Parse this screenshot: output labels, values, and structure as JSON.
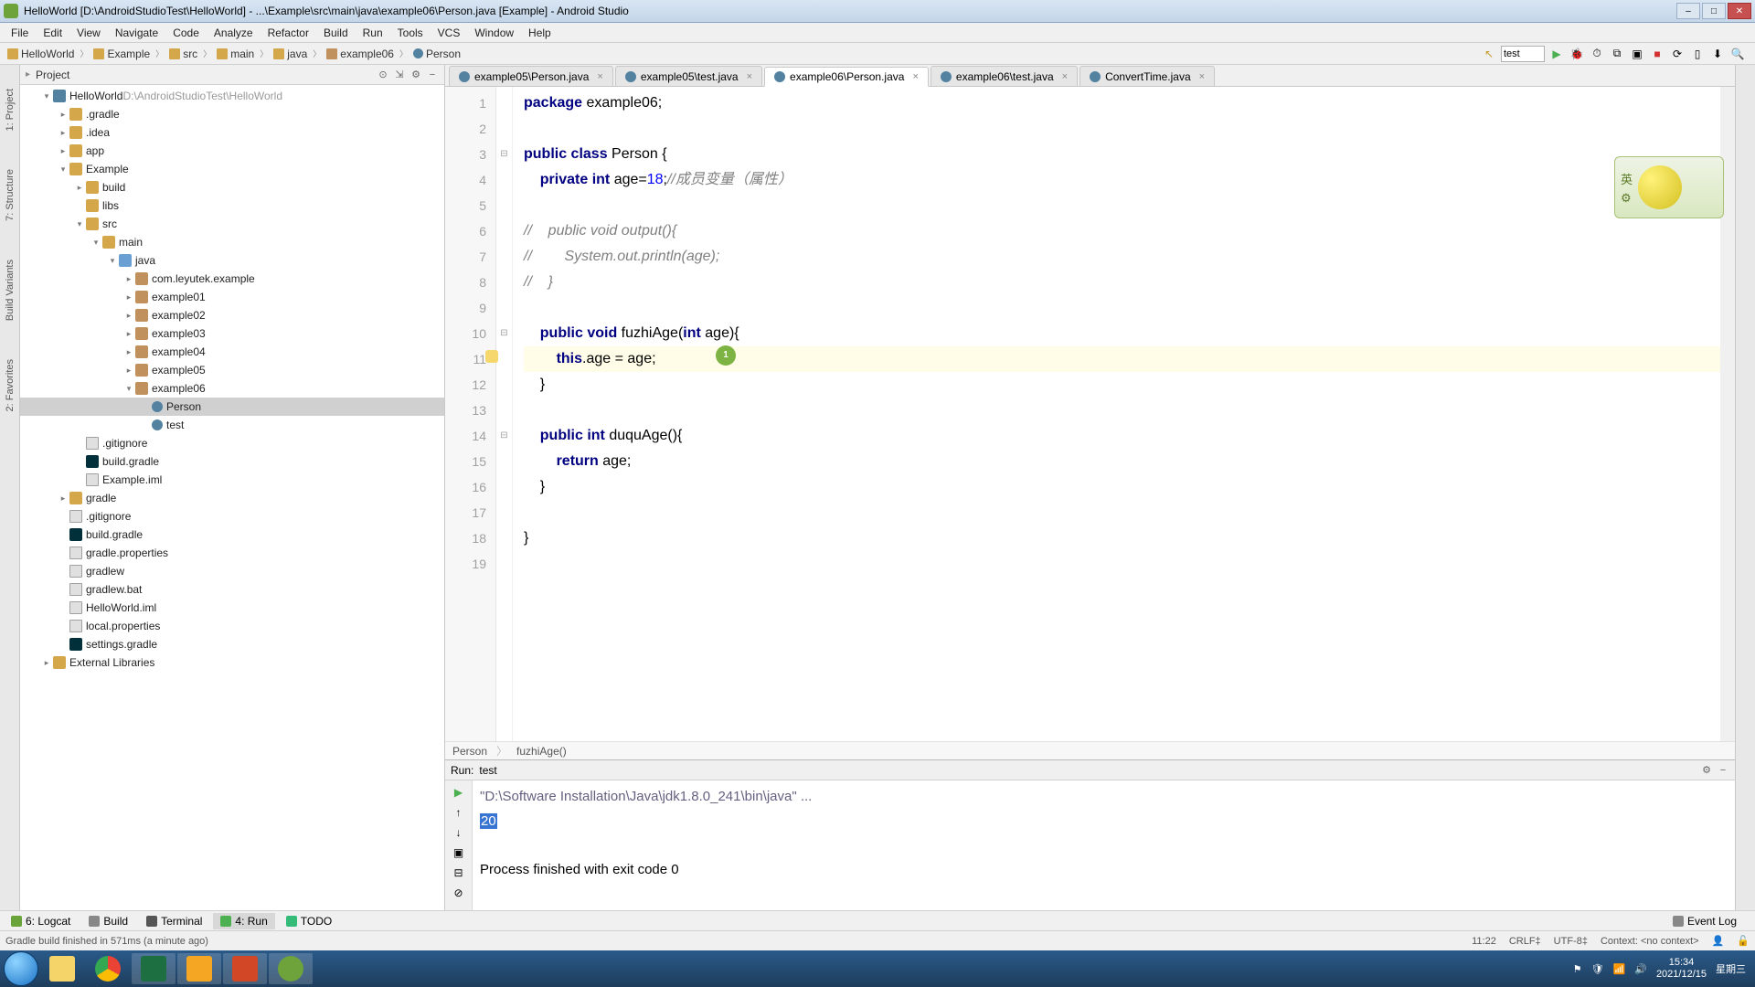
{
  "title": "HelloWorld  [D:\\AndroidStudioTest\\HelloWorld] - ...\\Example\\src\\main\\java\\example06\\Person.java [Example] - Android Studio",
  "menu": [
    "File",
    "Edit",
    "View",
    "Navigate",
    "Code",
    "Analyze",
    "Refactor",
    "Build",
    "Run",
    "Tools",
    "VCS",
    "Window",
    "Help"
  ],
  "breadcrumbs": [
    {
      "icon": "mod",
      "label": "HelloWorld"
    },
    {
      "icon": "mod",
      "label": "Example"
    },
    {
      "icon": "folder",
      "label": "src"
    },
    {
      "icon": "folder",
      "label": "main"
    },
    {
      "icon": "folder",
      "label": "java"
    },
    {
      "icon": "pkg",
      "label": "example06"
    },
    {
      "icon": "class",
      "label": "Person"
    }
  ],
  "run_config": "test",
  "left_gutter": [
    "1: Project",
    "7: Structure",
    "Build Variants",
    "2: Favorites"
  ],
  "project_panel": {
    "title": "Project"
  },
  "tree_root": {
    "name": "HelloWorld",
    "path": "D:\\AndroidStudioTest\\HelloWorld"
  },
  "tree": [
    {
      "d": 1,
      "ar": "▾",
      "ic": "mod",
      "t": "HelloWorld",
      "extra": "  D:\\AndroidStudioTest\\HelloWorld"
    },
    {
      "d": 2,
      "ar": "▸",
      "ic": "folder",
      "t": ".gradle"
    },
    {
      "d": 2,
      "ar": "▸",
      "ic": "folder",
      "t": ".idea"
    },
    {
      "d": 2,
      "ar": "▸",
      "ic": "folder",
      "t": "app"
    },
    {
      "d": 2,
      "ar": "▾",
      "ic": "folder",
      "t": "Example"
    },
    {
      "d": 3,
      "ar": "▸",
      "ic": "folder",
      "t": "build"
    },
    {
      "d": 3,
      "ar": " ",
      "ic": "folder",
      "t": "libs"
    },
    {
      "d": 3,
      "ar": "▾",
      "ic": "folder",
      "t": "src"
    },
    {
      "d": 4,
      "ar": "▾",
      "ic": "folder",
      "t": "main"
    },
    {
      "d": 5,
      "ar": "▾",
      "ic": "folder-blue",
      "t": "java"
    },
    {
      "d": 6,
      "ar": "▸",
      "ic": "pkg",
      "t": "com.leyutek.example"
    },
    {
      "d": 6,
      "ar": "▸",
      "ic": "pkg",
      "t": "example01"
    },
    {
      "d": 6,
      "ar": "▸",
      "ic": "pkg",
      "t": "example02"
    },
    {
      "d": 6,
      "ar": "▸",
      "ic": "pkg",
      "t": "example03"
    },
    {
      "d": 6,
      "ar": "▸",
      "ic": "pkg",
      "t": "example04"
    },
    {
      "d": 6,
      "ar": "▸",
      "ic": "pkg",
      "t": "example05"
    },
    {
      "d": 6,
      "ar": "▾",
      "ic": "pkg",
      "t": "example06"
    },
    {
      "d": 7,
      "ar": " ",
      "ic": "class",
      "t": "Person",
      "sel": true
    },
    {
      "d": 7,
      "ar": " ",
      "ic": "class",
      "t": "test"
    },
    {
      "d": 3,
      "ar": " ",
      "ic": "file",
      "t": ".gitignore"
    },
    {
      "d": 3,
      "ar": " ",
      "ic": "gradle",
      "t": "build.gradle"
    },
    {
      "d": 3,
      "ar": " ",
      "ic": "file",
      "t": "Example.iml"
    },
    {
      "d": 2,
      "ar": "▸",
      "ic": "folder",
      "t": "gradle"
    },
    {
      "d": 2,
      "ar": " ",
      "ic": "file",
      "t": ".gitignore"
    },
    {
      "d": 2,
      "ar": " ",
      "ic": "gradle",
      "t": "build.gradle"
    },
    {
      "d": 2,
      "ar": " ",
      "ic": "file",
      "t": "gradle.properties"
    },
    {
      "d": 2,
      "ar": " ",
      "ic": "file",
      "t": "gradlew"
    },
    {
      "d": 2,
      "ar": " ",
      "ic": "file",
      "t": "gradlew.bat"
    },
    {
      "d": 2,
      "ar": " ",
      "ic": "file",
      "t": "HelloWorld.iml"
    },
    {
      "d": 2,
      "ar": " ",
      "ic": "file",
      "t": "local.properties"
    },
    {
      "d": 2,
      "ar": " ",
      "ic": "gradle",
      "t": "settings.gradle"
    },
    {
      "d": 1,
      "ar": "▸",
      "ic": "folder",
      "t": "External Libraries"
    }
  ],
  "tabs": [
    {
      "label": "example05\\Person.java"
    },
    {
      "label": "example05\\test.java"
    },
    {
      "label": "example06\\Person.java",
      "active": true
    },
    {
      "label": "example06\\test.java"
    },
    {
      "label": "ConvertTime.java"
    }
  ],
  "code": {
    "lines": [
      [
        [
          "kw",
          "package "
        ],
        [
          "id",
          "example06"
        ],
        [
          "id",
          ";"
        ]
      ],
      [],
      [
        [
          "kw",
          "public class "
        ],
        [
          "id",
          "Person {"
        ]
      ],
      [
        [
          "id",
          "    "
        ],
        [
          "kw",
          "private int "
        ],
        [
          "id",
          "age="
        ],
        [
          "num",
          "18"
        ],
        [
          "id",
          ";"
        ],
        [
          "cmt",
          "//成员变量（属性）"
        ]
      ],
      [],
      [
        [
          "cmt",
          "//    public void output(){"
        ]
      ],
      [
        [
          "cmt",
          "//        System.out.println(age);"
        ]
      ],
      [
        [
          "cmt",
          "//    }"
        ]
      ],
      [],
      [
        [
          "id",
          "    "
        ],
        [
          "kw",
          "public void "
        ],
        [
          "id",
          "fuzhiAge("
        ],
        [
          "kw",
          "int "
        ],
        [
          "id",
          "age"
        ],
        [
          "id",
          "){"
        ]
      ],
      [
        [
          "id",
          "        "
        ],
        [
          "kw",
          "this"
        ],
        [
          "id",
          ".age = age;"
        ]
      ],
      [
        [
          "id",
          "    }"
        ]
      ],
      [],
      [
        [
          "id",
          "    "
        ],
        [
          "kw",
          "public int "
        ],
        [
          "id",
          "duquAge(){"
        ]
      ],
      [
        [
          "id",
          "        "
        ],
        [
          "kw",
          "return "
        ],
        [
          "id",
          "age;"
        ]
      ],
      [
        [
          "id",
          "    }"
        ]
      ],
      [],
      [
        [
          "id",
          "}"
        ]
      ],
      []
    ],
    "highlight_line": 11,
    "bulb_line": 11
  },
  "editor_breadcrumb": [
    "Person",
    "fuzhiAge()"
  ],
  "run": {
    "title": "Run:",
    "name": "test",
    "exec": "\"D:\\Software Installation\\Java\\jdk1.8.0_241\\bin\\java\" ...",
    "out_selected": "20",
    "exit": "Process finished with exit code 0"
  },
  "bottom_tabs": [
    {
      "icon": "#69a33a",
      "label": "6: Logcat"
    },
    {
      "icon": "#888",
      "label": "Build"
    },
    {
      "icon": "#555",
      "label": "Terminal"
    },
    {
      "icon": "#4caf50",
      "label": "4: Run",
      "active": true
    },
    {
      "icon": "#3b7",
      "label": "TODO"
    }
  ],
  "event_log": "Event Log",
  "status": {
    "msg": "Gradle build finished in 571ms (a minute ago)",
    "pos": "11:22",
    "crlf": "CRLF‡",
    "enc": "UTF-8‡",
    "ctx": "Context: <no context>"
  },
  "tray": {
    "time": "15:34",
    "date": "2021/12/15",
    "dow": "星期三"
  }
}
